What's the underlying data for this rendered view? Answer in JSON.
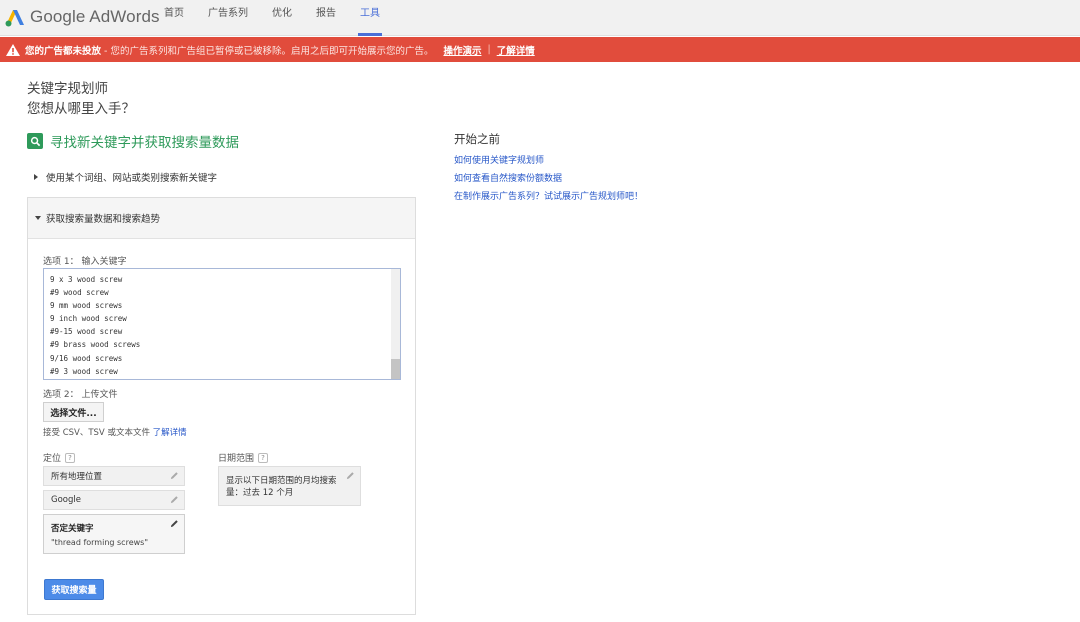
{
  "brand": {
    "logo_text": "Google AdWords"
  },
  "nav": [
    {
      "label": "首页",
      "active": false
    },
    {
      "label": "广告系列",
      "active": false
    },
    {
      "label": "优化",
      "active": false
    },
    {
      "label": "报告",
      "active": false
    },
    {
      "label": "工具",
      "active": true
    }
  ],
  "alert": {
    "title": "您的广告都未投放",
    "message": "- 您的广告系列和广告组已暂停或已被移除。启用之后即可开始展示您的广告。",
    "link_demo": "操作演示",
    "separator": "|",
    "link_details": "了解详情",
    "color": "#e14c3c"
  },
  "page": {
    "title": "关键字规划师",
    "subtitle": "您想从哪里入手？"
  },
  "section": {
    "title": "寻找新关键字并获取搜索量数据",
    "collapsed_option": "使用某个词组、网站或类别搜索新关键字",
    "panel_title": "获取搜索量数据和搜索趋势"
  },
  "option1": {
    "label": "选项 1： 输入关键字",
    "keywords": [
      "9 x 3 wood screw",
      "#9 wood screw",
      "9 mm wood screws",
      "9 inch wood screw",
      "#9-15 wood screw",
      "#9 brass wood screws",
      "9/16 wood screws",
      "#9 3 wood screw"
    ]
  },
  "option2": {
    "label": "选项 2： 上传文件",
    "button": "选择文件...",
    "accept_text": "接受 CSV、TSV 或文本文件",
    "accept_link": "了解详情"
  },
  "targeting": {
    "label": "定位",
    "location": "所有地理位置",
    "network": "Google",
    "negative_title": "否定关键字",
    "negative_value": "\"thread forming screws\""
  },
  "date_range": {
    "label": "日期范围",
    "value": "显示以下日期范围的月均搜索量：过去 12 个月"
  },
  "qmark": "?",
  "submit": {
    "label": "获取搜索量"
  },
  "sidebar": {
    "title": "开始之前",
    "links": [
      "如何使用关键字规划师",
      "如何查看自然搜索份额数据",
      "在制作展示广告系列？试试展示广告规划师吧！"
    ]
  }
}
